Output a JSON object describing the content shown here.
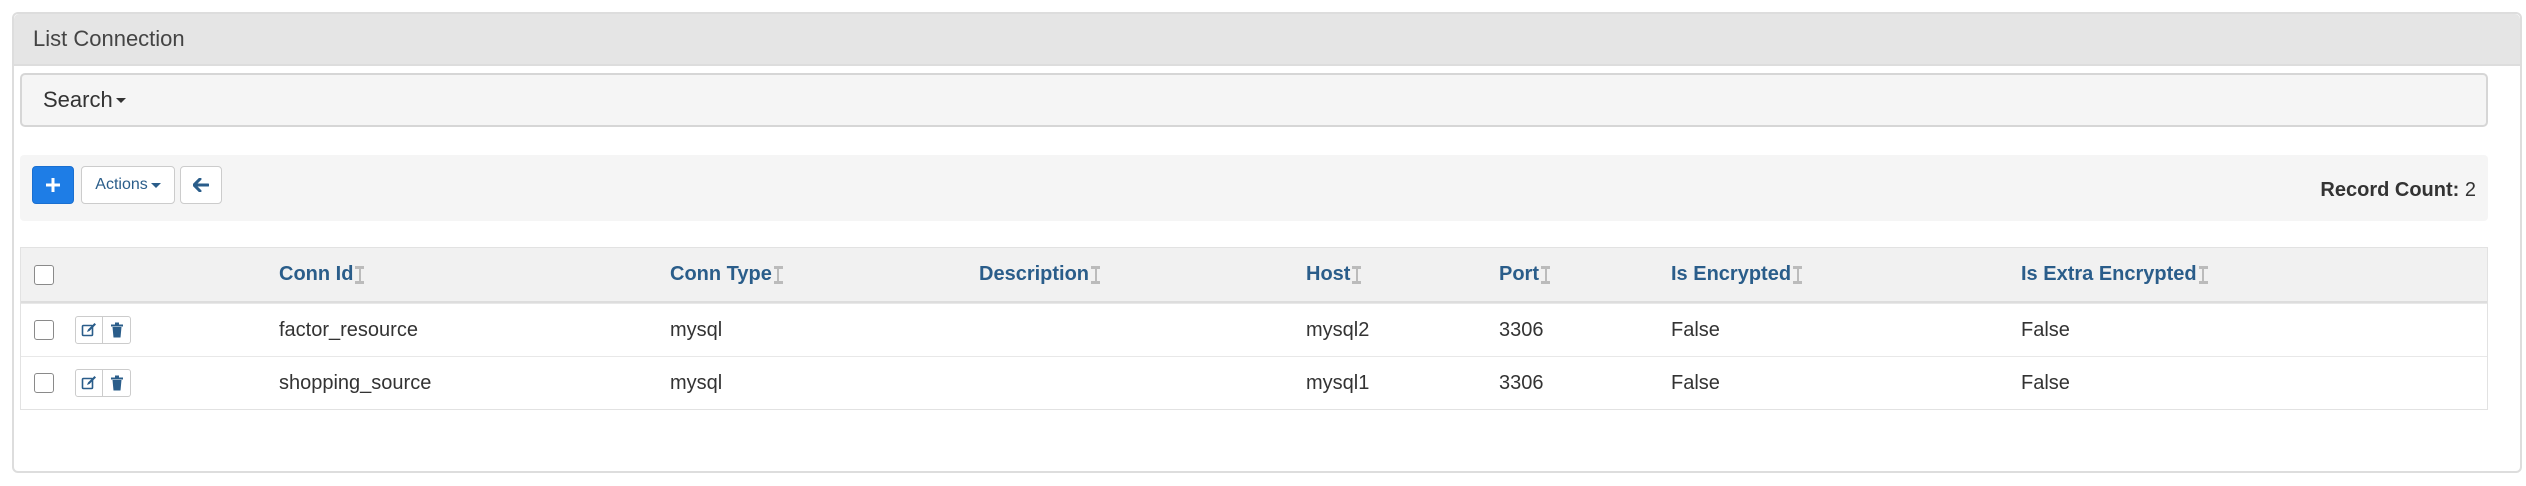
{
  "panel": {
    "title": "List Connection"
  },
  "search": {
    "label": "Search"
  },
  "toolbar": {
    "actions_label": "Actions",
    "record_count_label": "Record Count:",
    "record_count_value": "2"
  },
  "table": {
    "columns": [
      "Conn Id",
      "Conn Type",
      "Description",
      "Host",
      "Port",
      "Is Encrypted",
      "Is Extra Encrypted"
    ],
    "rows": [
      [
        "factor_resource",
        "mysql",
        "",
        "mysql2",
        "3306",
        "False",
        "False"
      ],
      [
        "shopping_source",
        "mysql",
        "",
        "mysql1",
        "3306",
        "False",
        "False"
      ]
    ]
  },
  "colors": {
    "primary": "#1e7de6",
    "link": "#2a5d8a",
    "header_bg": "#e5e5e5"
  },
  "icons": {
    "add": "plus-icon",
    "back": "arrow-left-icon",
    "edit": "edit-icon",
    "delete": "trash-icon"
  }
}
